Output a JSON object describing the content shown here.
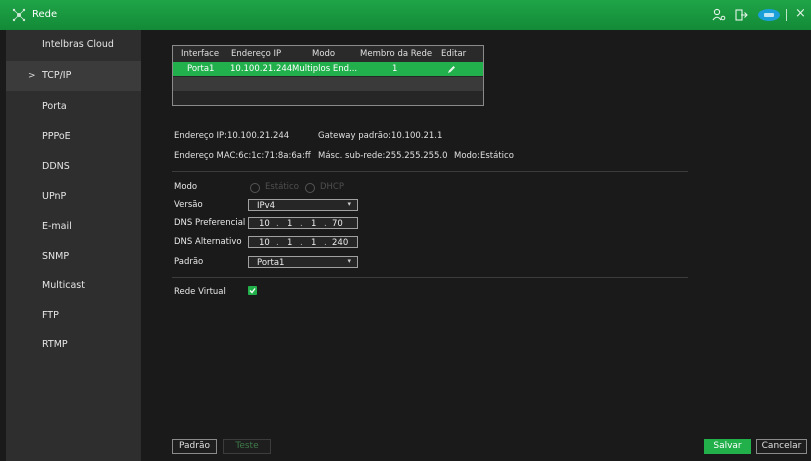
{
  "window": {
    "title": "Rede"
  },
  "sidebar": {
    "items": [
      {
        "label": "Intelbras Cloud"
      },
      {
        "label": "TCP/IP",
        "active": true
      },
      {
        "label": "Porta"
      },
      {
        "label": "PPPoE"
      },
      {
        "label": "DDNS"
      },
      {
        "label": "UPnP"
      },
      {
        "label": "E-mail"
      },
      {
        "label": "SNMP"
      },
      {
        "label": "Multicast"
      },
      {
        "label": "FTP"
      },
      {
        "label": "RTMP"
      }
    ],
    "active_arrow": ">"
  },
  "interfaces_table": {
    "columns": [
      "Interface",
      "Endereço IP",
      "Modo",
      "Membro da Rede",
      "Editar"
    ],
    "rows": [
      {
        "interface": "Porta1",
        "ip": "10.100.21.244",
        "mode": "Multiplos End...",
        "member": "1",
        "edit_icon": "pencil-icon"
      }
    ]
  },
  "info": {
    "ip": "Endereço IP:10.100.21.244",
    "gateway": "Gateway padrão:10.100.21.1",
    "mac": "Endereço MAC:6c:1c:71:8a:6a:ff",
    "mask": "Másc. sub-rede:255.255.255.0",
    "mode": "Modo:Estático"
  },
  "form": {
    "mode_label": "Modo",
    "mode_options": [
      "Estático",
      "DHCP"
    ],
    "version_label": "Versão",
    "version_value": "IPv4",
    "dns_pref_label": "DNS Preferencial",
    "dns_pref": [
      "10",
      "1",
      "1",
      "70"
    ],
    "dns_alt_label": "DNS Alternativo",
    "dns_alt": [
      "10",
      "1",
      "1",
      "240"
    ],
    "default_label": "Padrão",
    "default_value": "Porta1",
    "virtual_label": "Rede Virtual",
    "virtual_checked": true
  },
  "buttons": {
    "default": "Padrão",
    "test": "Teste",
    "save": "Salvar",
    "cancel": "Cancelar"
  },
  "colors": {
    "accent": "#22b04b",
    "titlebar": "#1a9a42",
    "sidebar": "#2e2e2e",
    "background": "#1a1a1a",
    "cloud_icon": "#1a9fd9"
  }
}
